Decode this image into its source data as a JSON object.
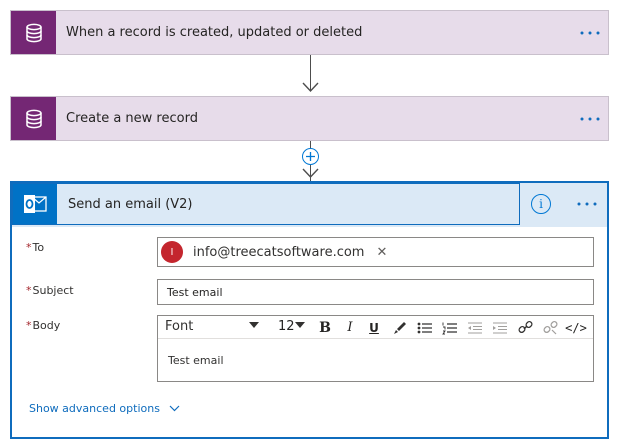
{
  "trigger": {
    "title": "When a record is created, updated or deleted",
    "icon": "database-icon"
  },
  "action": {
    "title": "Create a new record",
    "icon": "database-icon"
  },
  "email": {
    "title": "Send an email (V2)",
    "icon": "outlook-icon",
    "info": "i",
    "fields": {
      "to_label": "To",
      "subject_label": "Subject",
      "body_label": "Body",
      "to_chip": {
        "initial": "I",
        "email": "info@treecatsoftware.com",
        "remove": "✕"
      },
      "subject_value": "Test email",
      "body_value": "Test email"
    },
    "toolbar": {
      "font": "Font",
      "size": "12",
      "bold": "B",
      "italic": "I",
      "underline": "U",
      "code": "</>"
    },
    "advanced": "Show advanced options"
  },
  "colors": {
    "accent": "#0f6cbd",
    "dataverse": "#742774",
    "outlook": "#0072c6",
    "required": "#a4262c"
  }
}
